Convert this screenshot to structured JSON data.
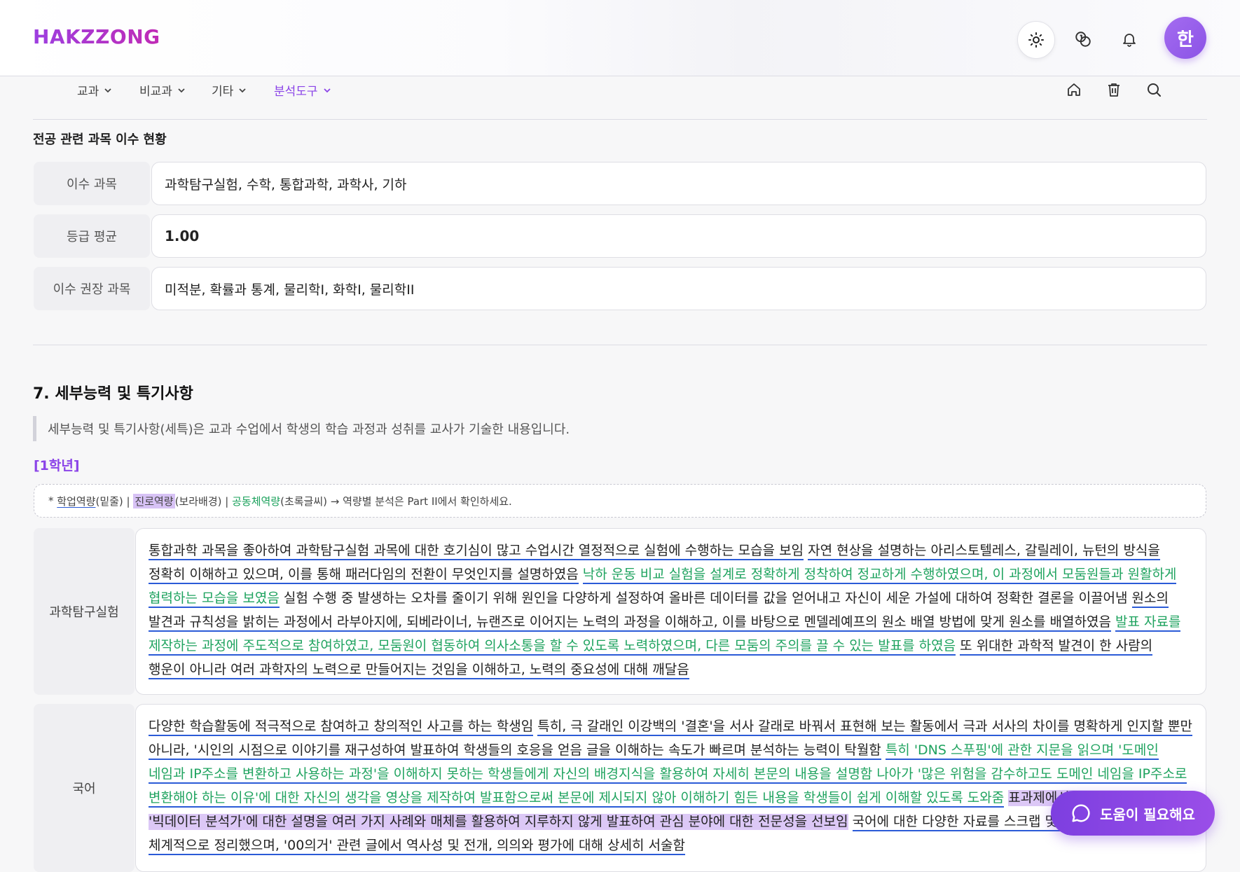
{
  "header": {
    "logo": "HAKZZONG",
    "avatar_initial": "한",
    "icons": [
      "sun-icon",
      "coins-icon",
      "bell-icon"
    ]
  },
  "nav": {
    "items": [
      {
        "label": "교과"
      },
      {
        "label": "비교과"
      },
      {
        "label": "기타"
      },
      {
        "label": "분석도구",
        "active": true
      }
    ],
    "tools": [
      "home-icon",
      "trash-icon",
      "search-icon"
    ]
  },
  "major_courses": {
    "title": "전공 관련 과목 이수 현황",
    "rows": [
      {
        "label": "이수 과목",
        "value": "과학탐구실험, 수학, 통합과학, 과학사, 기하"
      },
      {
        "label": "등급 평균",
        "value": "1.00"
      },
      {
        "label": "이수 권장 과목",
        "value": "미적분, 확률과 통계, 물리학I, 화학I, 물리학II"
      }
    ]
  },
  "section7": {
    "title": "7. 세부능력 및 특기사항",
    "description": "세부능력 및 특기사항(세특)은 교과 수업에서 학생의 학습 과정과 성취를 교사가 기술한 내용입니다.",
    "grade": "[1학년]",
    "legend": {
      "prefix": "* ",
      "academic": "학업역량",
      "academic_note": "(밑줄) | ",
      "career": "진로역량",
      "career_note": "(보라배경) | ",
      "community": "공동체역량",
      "community_note": "(초록글씨) → 역량별 분석은 Part II에서 확인하세요."
    },
    "subjects": [
      {
        "name": "과학탐구실험",
        "segments": [
          {
            "t": "a",
            "text": "통합과학 과목을 좋아하여 과학탐구실험 과목에 대한 호기심이 많고 수업시간 열정적으로 실험에 수행하는 모습을 보임"
          },
          {
            "t": "n",
            "text": " "
          },
          {
            "t": "a",
            "text": "자연 현상을 설명하는 아리스토텔레스, 갈릴레이, 뉴턴의 방식을 정확히 이해하고 있으며, 이를 통해 패러다임의 전환이 무엇인지를 설명하였음"
          },
          {
            "t": "n",
            "text": " "
          },
          {
            "t": "g",
            "text": "낙하 운동 비교 실험을 설계로 정확하게 정착하여 정교하게 수행하였으며, 이 과정에서 모둠원들과 원활하게 협력하는 모습을 보였음"
          },
          {
            "t": "n",
            "text": " 실험 수행 중 발생하는 오차를 줄이기 위해 원인을 다양하게 설정하여 올바른 데이터를 값을 얻어내고 자신이 세운 가설에 대하여 정확한 결론을 이끌어냄 "
          },
          {
            "t": "a",
            "text": "원소의 발견과 규칙성을 밝히는 과정에서 라부아지에, 되베라이너, 뉴랜즈로 이어지는 노력의 과정을 이해하고, 이를 바탕으로 멘델레예프의 원소 배열 방법에 맞게 원소를 배열하였음"
          },
          {
            "t": "n",
            "text": " "
          },
          {
            "t": "g",
            "text": "발표 자료를 제작하는 과정에 주도적으로 참여하였고, 모둠원이 협동하여 의사소통을 할 수 있도록 노력하였으며, 다른 모둠의 주의를 끌 수 있는 발표를 하였음"
          },
          {
            "t": "n",
            "text": " "
          },
          {
            "t": "a",
            "text": "또 위대한 과학적 발견이 한 사람의 행운이 아니라 여러 과학자의 노력으로 만들어지는 것임을 이해하고, 노력의 중요성에 대해 깨달음"
          }
        ]
      },
      {
        "name": "국어",
        "segments": [
          {
            "t": "a",
            "text": "다양한 학습활동에 적극적으로 참여하고 창의적인 사고를 하는 학생임"
          },
          {
            "t": "n",
            "text": " "
          },
          {
            "t": "a",
            "text": "특히, 극 갈래인 이강백의 '결혼'을 서사 갈래로 바꿔서 표현해 보는 활동에서 극과 서사의 차이를 명확하게 인지할 뿐만 아니라, '시인의 시점으로 이야기를 재구성하여 발표하여 학생들의 호응을 얻음 글을 이해하는 속도가 빠르며 분석하는 능력이 탁월함"
          },
          {
            "t": "n",
            "text": " "
          },
          {
            "t": "g",
            "text": "특히 'DNS 스푸핑'에 관한 지문을 읽으며 '도메인 네임과 IP주소를 변환하고 사용하는 과정'을 이해하지 못하는 학생들에게 자신의 배경지식을 활용하여 자세히 본문의 내용을 설명함 나아가 '많은 위험을 감수하고도 도메인 네임을 IP주소로 변환해야 하는 이유'에 대한 자신의 생각을 영상을 제작하여 발표함으로써 본문에 제시되지 않아 이해하기 힘든 내용을 학생들이 쉽게 이해할 있도록 도와줌"
          },
          {
            "t": "n",
            "text": " "
          },
          {
            "t": "p",
            "text": "표과제에서 자신의 선호 직업인 '빅데이터 분석가'에 대한 설명을 여러 가지 사례와 매체를 활용하여 지루하지 않게 발표하여 관심 분야에 대한 전문성을 선보임"
          },
          {
            "t": "n",
            "text": " "
          },
          {
            "t": "a",
            "text": "국어에 대한 다양한 자료를 스크랩 및 밑줄긋기를 하여 내용을 체계적으로 정리했으며, '00의거' 관련 글에서 역사성 및 전개, 의의와 평가에 대해 상세히 서술함"
          }
        ]
      }
    ]
  },
  "help_button": {
    "label": "도움이 필요해요"
  }
}
